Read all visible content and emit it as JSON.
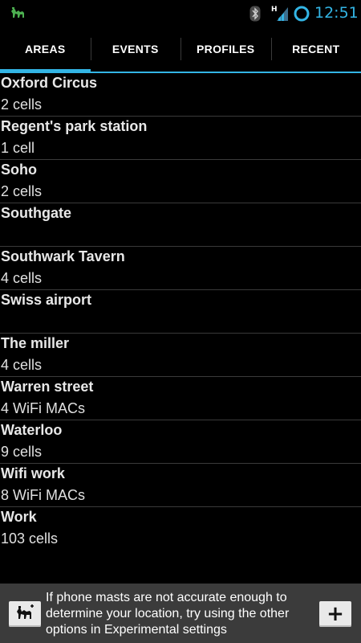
{
  "status_bar": {
    "time": "12:51",
    "network_type": "H",
    "accent_color": "#33b5e5"
  },
  "tabs": [
    {
      "label": "AREAS",
      "active": true
    },
    {
      "label": "EVENTS",
      "active": false
    },
    {
      "label": "PROFILES",
      "active": false
    },
    {
      "label": "RECENT",
      "active": false
    }
  ],
  "areas": [
    {
      "name": "Oxford Circus",
      "detail": "2 cells"
    },
    {
      "name": "Regent's park station",
      "detail": "1 cell"
    },
    {
      "name": "Soho",
      "detail": "2 cells"
    },
    {
      "name": "Southgate",
      "detail": ""
    },
    {
      "name": "Southwark Tavern",
      "detail": "4 cells"
    },
    {
      "name": "Swiss airport",
      "detail": ""
    },
    {
      "name": "The miller",
      "detail": "4 cells"
    },
    {
      "name": "Warren street",
      "detail": "4 WiFi MACs"
    },
    {
      "name": "Waterloo",
      "detail": "9 cells"
    },
    {
      "name": "Wifi work",
      "detail": "8 WiFi MACs"
    },
    {
      "name": "Work",
      "detail": "103 cells"
    }
  ],
  "footer": {
    "hint": "If phone masts are not accurate enough to determine your location, try using the other options in Experimental settings",
    "add_label": "+"
  },
  "icons": {
    "app": "camel-icon",
    "bluetooth": "bluetooth-icon",
    "signal": "signal-icon",
    "sync": "sync-icon",
    "footer_left": "camel-icon"
  }
}
